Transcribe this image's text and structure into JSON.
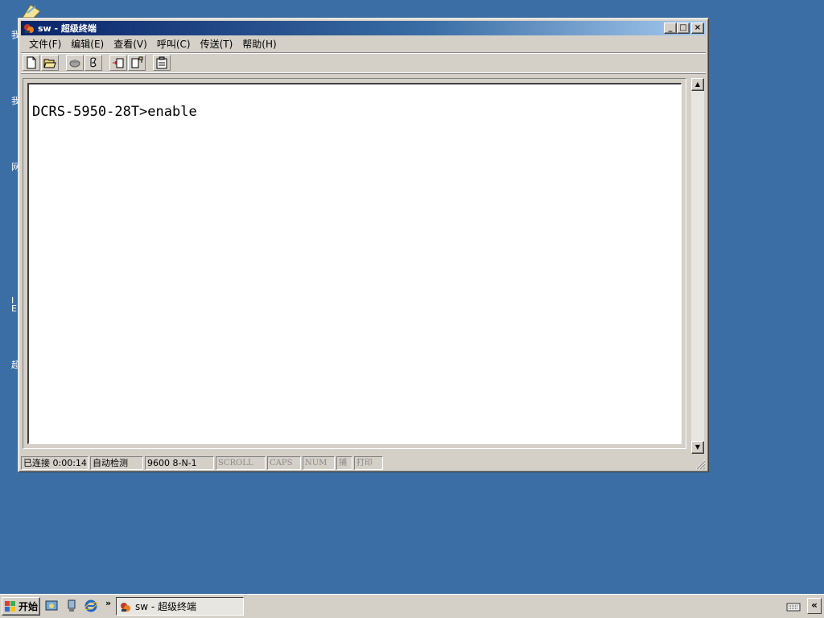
{
  "desktop": {
    "icon_fragments": [
      "我",
      "我",
      "网",
      "I",
      "E",
      "超"
    ]
  },
  "window": {
    "title": "sw - 超级终端",
    "controls": {
      "minimize": "_",
      "maximize": "□",
      "close": "×"
    }
  },
  "menu": {
    "items": [
      "文件(F)",
      "编辑(E)",
      "查看(V)",
      "呼叫(C)",
      "传送(T)",
      "帮助(H)"
    ]
  },
  "toolbar": {
    "icons": [
      "new-icon",
      "open-icon",
      "connect-icon",
      "disconnect-icon",
      "send-icon",
      "receive-icon",
      "properties-icon"
    ]
  },
  "terminal": {
    "lines": [
      "",
      "DCRS-5950-28T>enable"
    ]
  },
  "status": {
    "connection": "已连接 0:00:14",
    "detect": "自动检测",
    "port_settings": "9600 8-N-1",
    "scroll": "SCROLL",
    "caps": "CAPS",
    "num": "NUM",
    "capture": "捕",
    "print": "打印"
  },
  "taskbar": {
    "start_label": "开始",
    "quick_launch_more": "»",
    "task_label": "sw - 超级终端",
    "tray_expand": "«"
  }
}
